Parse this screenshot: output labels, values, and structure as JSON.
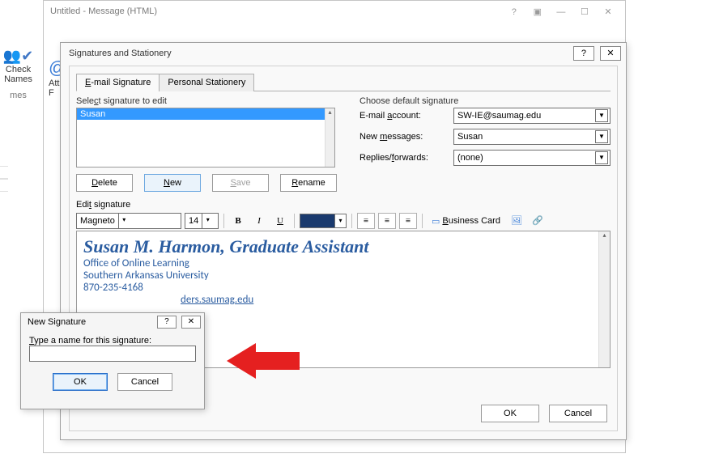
{
  "window": {
    "title": "Untitled - Message (HTML)"
  },
  "ribbon": {
    "check_names": "Check Names",
    "mes_cut": "mes",
    "att_cut": "Att\nF"
  },
  "dialog": {
    "title": "Signatures and Stationery",
    "tabs": {
      "email_signature": "E-mail Signature",
      "personal_stationery": "Personal Stationery"
    },
    "select_label": "Select signature to edit",
    "signatures": [
      "Susan"
    ],
    "buttons": {
      "delete": "Delete",
      "new": "New",
      "save": "Save",
      "rename": "Rename"
    },
    "defaults": {
      "header": "Choose default signature",
      "account_label": "E-mail account:",
      "account_value": "SW-IE@saumag.edu",
      "new_messages_label": "New messages:",
      "new_messages_value": "Susan",
      "replies_label": "Replies/forwards:",
      "replies_value": "(none)"
    },
    "edit_label": "Edit signature",
    "toolbar": {
      "font": "Magneto",
      "size": "14",
      "business_card": "Business Card"
    },
    "signature_preview": {
      "line1": "Susan M. Harmon, Graduate Assistant",
      "line2": "Office of Online Learning",
      "line3": "Southern Arkansas University",
      "line4": "870-235-4168",
      "link_fragment": "ders.saumag.edu"
    },
    "footer": {
      "ok": "OK",
      "cancel": "Cancel"
    }
  },
  "new_signature_dialog": {
    "title": "New Signature",
    "prompt": "Type a name for this signature:",
    "value": "",
    "ok": "OK",
    "cancel": "Cancel"
  }
}
